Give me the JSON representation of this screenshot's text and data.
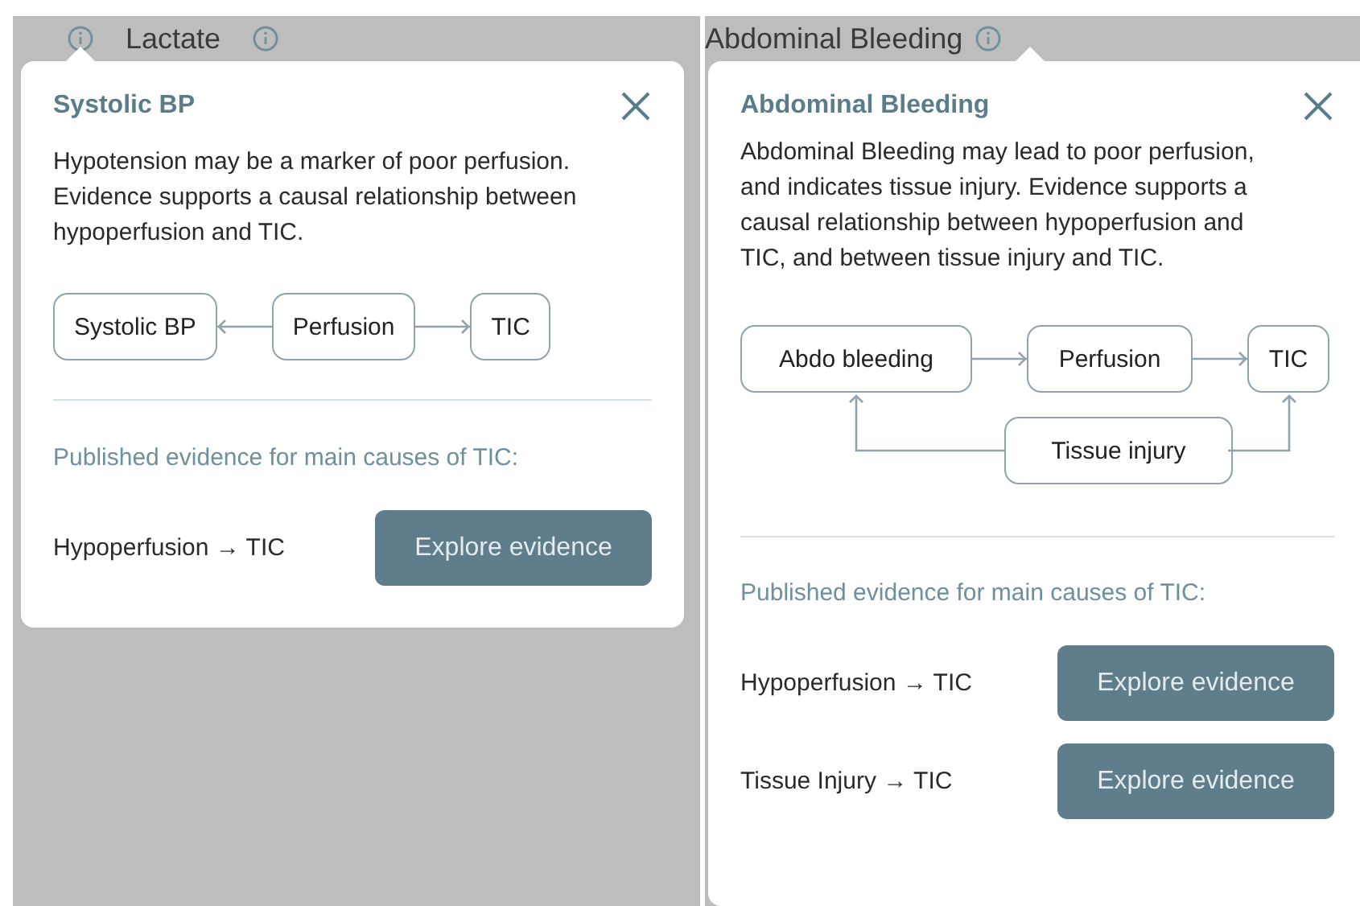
{
  "panels": [
    {
      "header": {
        "label": "Lactate"
      },
      "popover": {
        "title": "Systolic BP",
        "description": "Hypotension may be a marker of poor perfusion. Evidence supports a causal relationship between hypoperfusion and TIC.",
        "diagram": {
          "kind": "chain",
          "nodes": [
            "Systolic BP",
            "Perfusion",
            "TIC"
          ]
        },
        "evidence_heading": "Published evidence for main causes of TIC:",
        "evidence": [
          {
            "label": "Hypoperfusion → TIC",
            "button": "Explore evidence"
          }
        ]
      }
    },
    {
      "header": {
        "label": "Abdominal Bleeding"
      },
      "popover": {
        "title": "Abdominal Bleeding",
        "description": "Abdominal Bleeding may lead to poor perfusion, and indicates tissue injury. Evidence supports a causal relationship between hypoperfusion and TIC, and between tissue injury and TIC.",
        "diagram": {
          "kind": "branch",
          "nodes": [
            "Abdo bleeding",
            "Perfusion",
            "TIC",
            "Tissue injury"
          ]
        },
        "evidence_heading": "Published evidence for main causes of TIC:",
        "evidence": [
          {
            "label": "Hypoperfusion → TIC",
            "button": "Explore evidence"
          },
          {
            "label": "Tissue Injury → TIC",
            "button": "Explore evidence"
          }
        ]
      }
    }
  ]
}
